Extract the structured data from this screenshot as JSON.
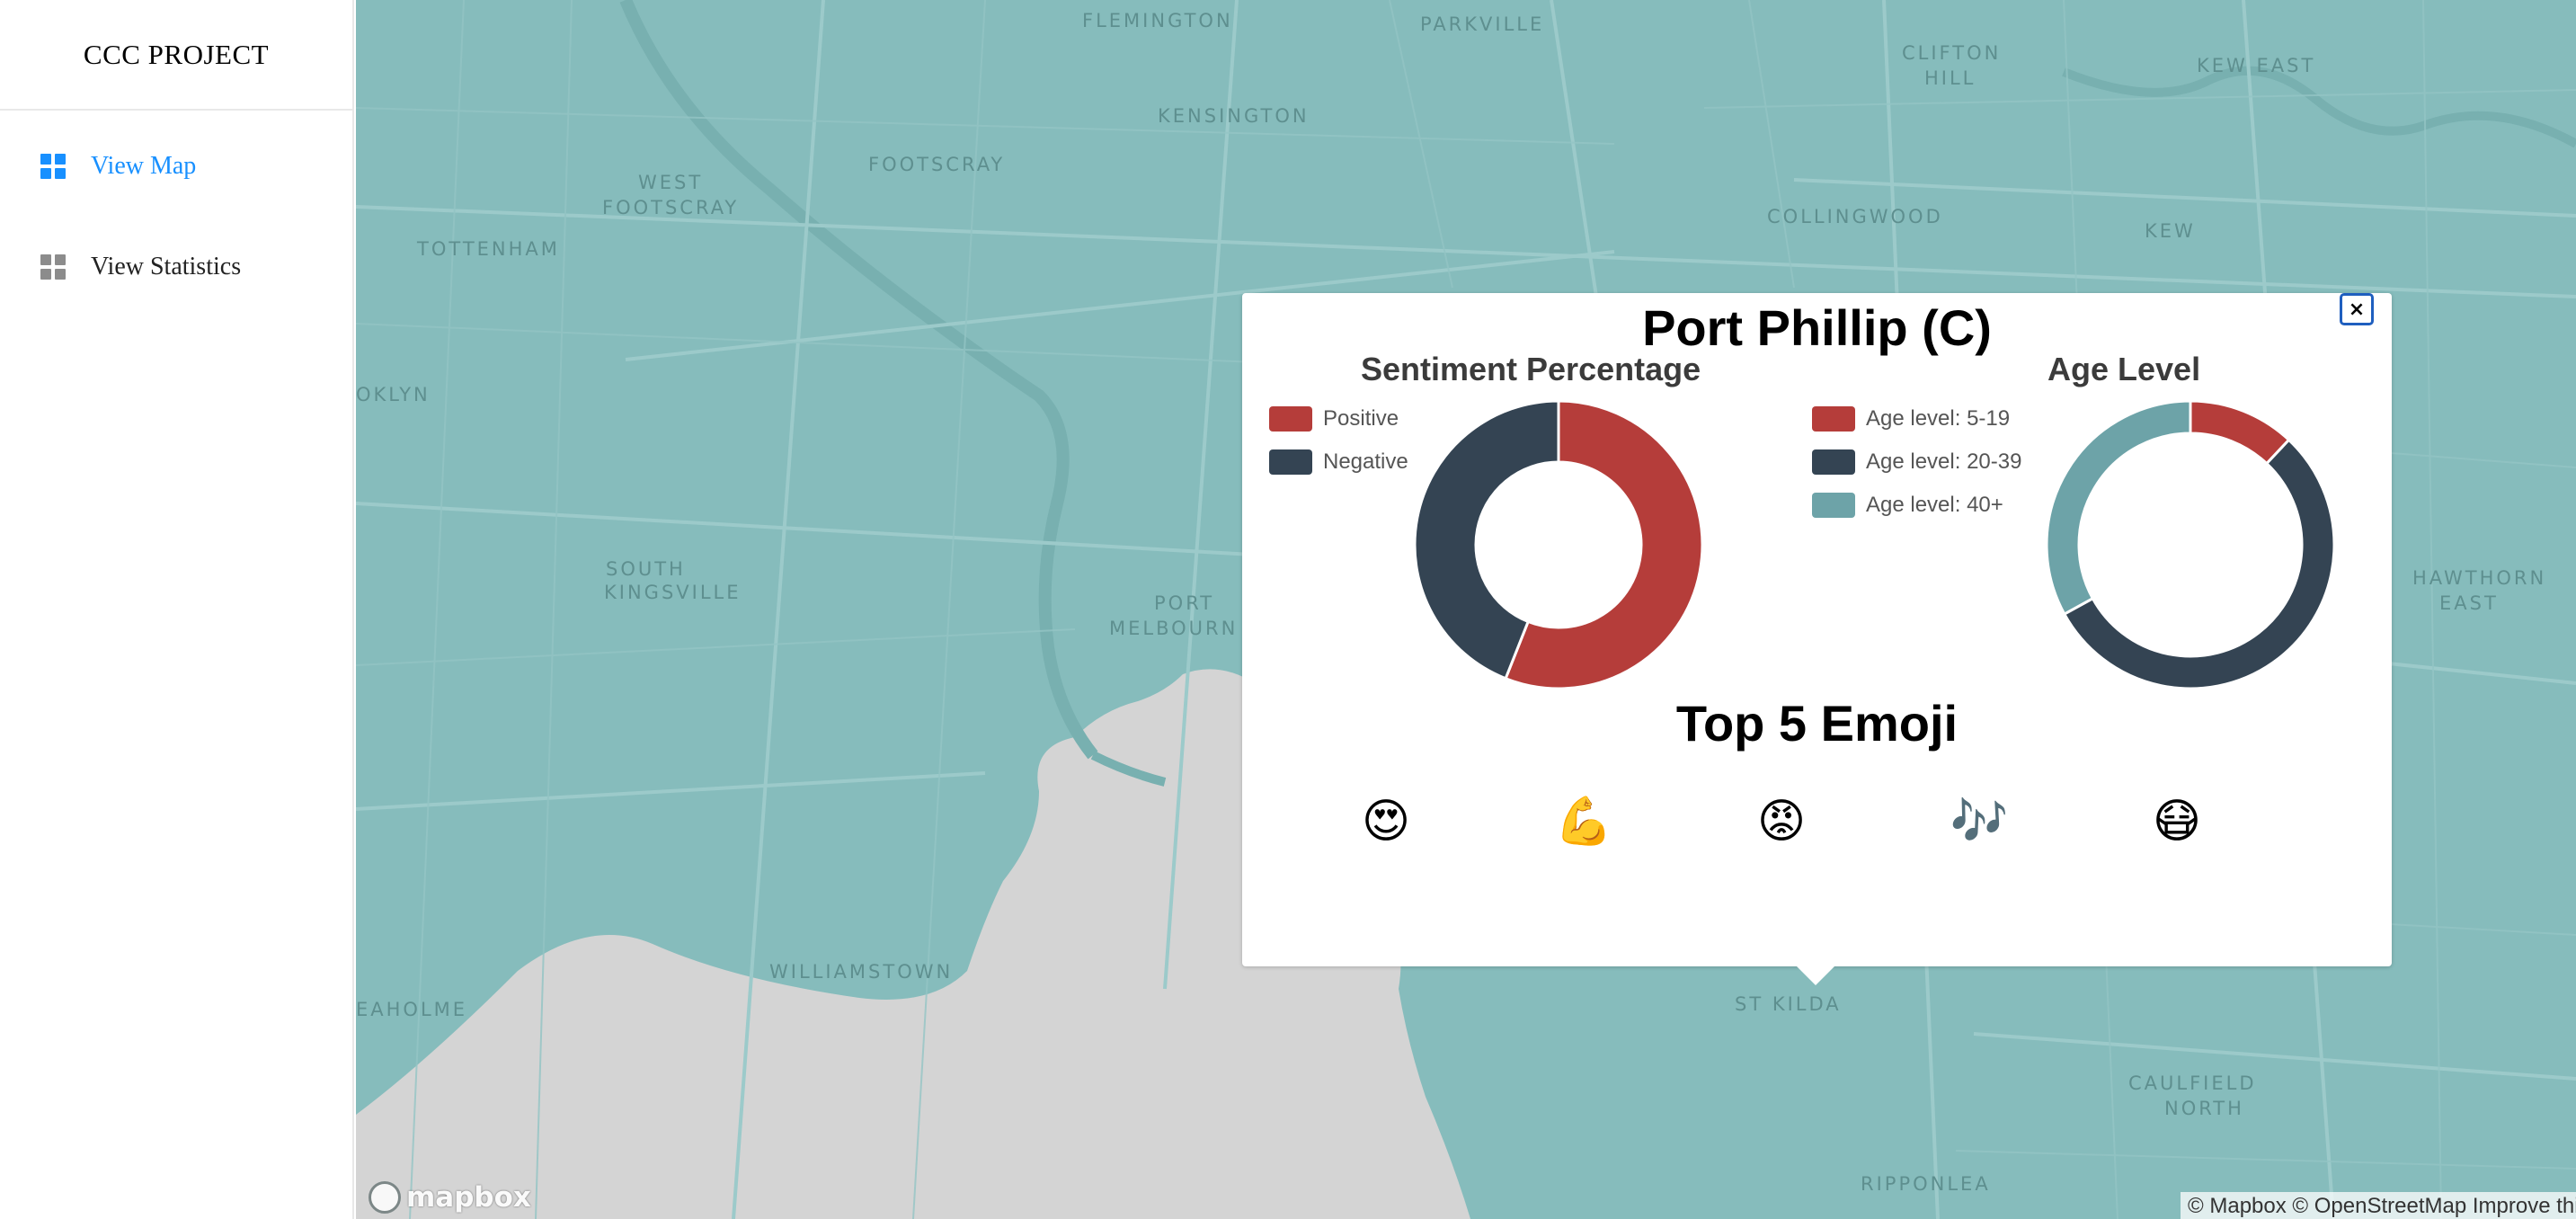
{
  "sidebar": {
    "title": "CCC PROJECT",
    "items": [
      {
        "label": "View Map",
        "icon": "appstore-icon",
        "active": true
      },
      {
        "label": "View Statistics",
        "icon": "appstore-icon",
        "active": false
      }
    ]
  },
  "map": {
    "places": [
      "FLEMINGTON",
      "PARKVILLE",
      "CLIFTON",
      "HILL",
      "KEW EAST",
      "KENSINGTON",
      "FOOTSCRAY",
      "WEST",
      "FOOTSCRAY",
      "COLLINGWOOD",
      "TOTTENHAM",
      "KEW",
      "OKLYN",
      "SOUTH",
      "KINGSVILLE",
      "PORT",
      "MELBOURN",
      "HAWTHORN",
      "EAST",
      "WILLIAMSTOWN",
      "EAHOLME",
      "ST KILDA",
      "CAULFIELD",
      "NORTH",
      "RIPPONLEA"
    ],
    "logo": "mapbox",
    "attribution": "© Mapbox © OpenStreetMap Improve this map",
    "colors": {
      "land": "#86bcbc",
      "water": "#d4d4d4",
      "roads": "#9dcaca"
    }
  },
  "popup": {
    "title": "Port Phillip (C)",
    "close_label": "×",
    "sentiment": {
      "title": "Sentiment Percentage",
      "legend": [
        {
          "label": "Positive",
          "color": "#b53d3a"
        },
        {
          "label": "Negative",
          "color": "#344453"
        }
      ]
    },
    "age": {
      "title": "Age Level",
      "legend": [
        {
          "label": "Age level: 5-19",
          "color": "#b53d3a"
        },
        {
          "label": "Age level: 20-39",
          "color": "#344453"
        },
        {
          "label": "Age level: 40+",
          "color": "#6da3a8"
        }
      ]
    },
    "emoji_title": "Top 5 Emoji",
    "emojis": [
      "😍",
      "💪",
      "😡",
      "🎶",
      "😷"
    ]
  },
  "chart_data": [
    {
      "type": "pie",
      "title": "Sentiment Percentage",
      "categories": [
        "Positive",
        "Negative"
      ],
      "values": [
        56,
        44
      ],
      "colors": [
        "#b53d3a",
        "#344453"
      ],
      "legend": "left"
    },
    {
      "type": "pie",
      "title": "Age Level",
      "categories": [
        "Age level: 5-19",
        "Age level: 20-39",
        "Age level: 40+"
      ],
      "values": [
        12,
        55,
        33
      ],
      "colors": [
        "#b53d3a",
        "#344453",
        "#6da3a8"
      ],
      "legend": "left"
    }
  ]
}
